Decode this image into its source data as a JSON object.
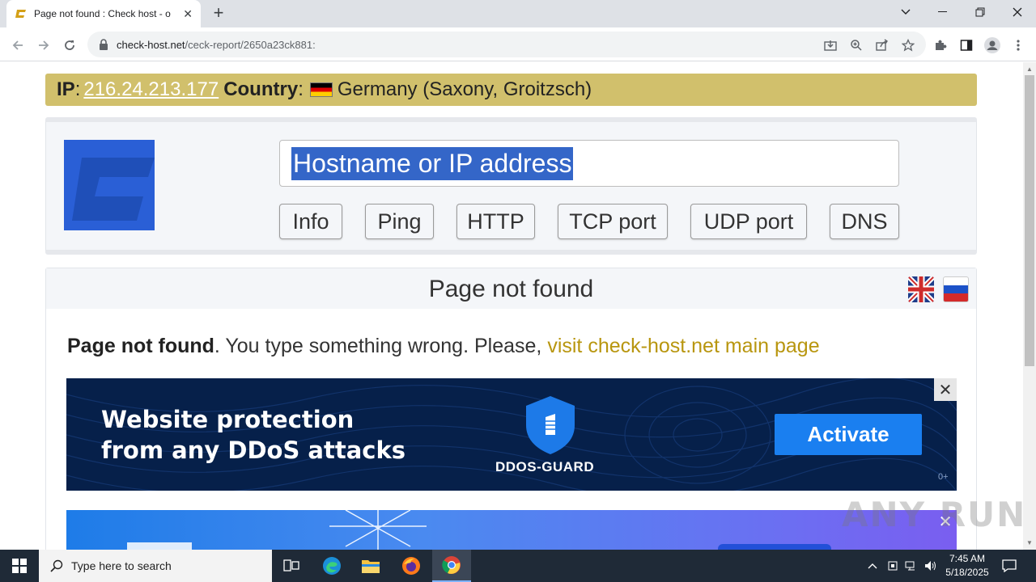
{
  "browser": {
    "tab_title": "Page not found : Check host - o",
    "tab_close": "✕",
    "new_tab": "+",
    "url_host": "check-host.net",
    "url_path": "/ceck-report/2650a23ck881:"
  },
  "ipbar": {
    "ip_label": "IP",
    "ip_value": "216.24.213.177",
    "country_label": "Country",
    "country_value": "Germany (Saxony, Groitzsch)"
  },
  "search": {
    "placeholder": "Hostname or IP address",
    "buttons": [
      "Info",
      "Ping",
      "HTTP",
      "TCP port",
      "UDP port",
      "DNS"
    ]
  },
  "notfound": {
    "title": "Page not found",
    "bold": "Page not found",
    "message": ". You type something wrong. Please, ",
    "link": "visit check-host.net main page"
  },
  "ad1": {
    "headline_1": "Website protection",
    "headline_2": "from any DDoS attacks",
    "brand": "DDOS-GUARD",
    "cta": "Activate",
    "age": "0+",
    "close": "✕"
  },
  "ad2": {
    "close": "✕"
  },
  "watermark": "ANY RUN",
  "taskbar": {
    "search_placeholder": "Type here to search",
    "time": "7:45 AM",
    "date": "5/18/2025"
  },
  "colors": {
    "ipbar_bg": "#d1c06c",
    "link": "#b8960f",
    "logo_blue": "#2a5fd6",
    "ad_bg": "#06204a",
    "ad_cta": "#1a7ff0"
  }
}
